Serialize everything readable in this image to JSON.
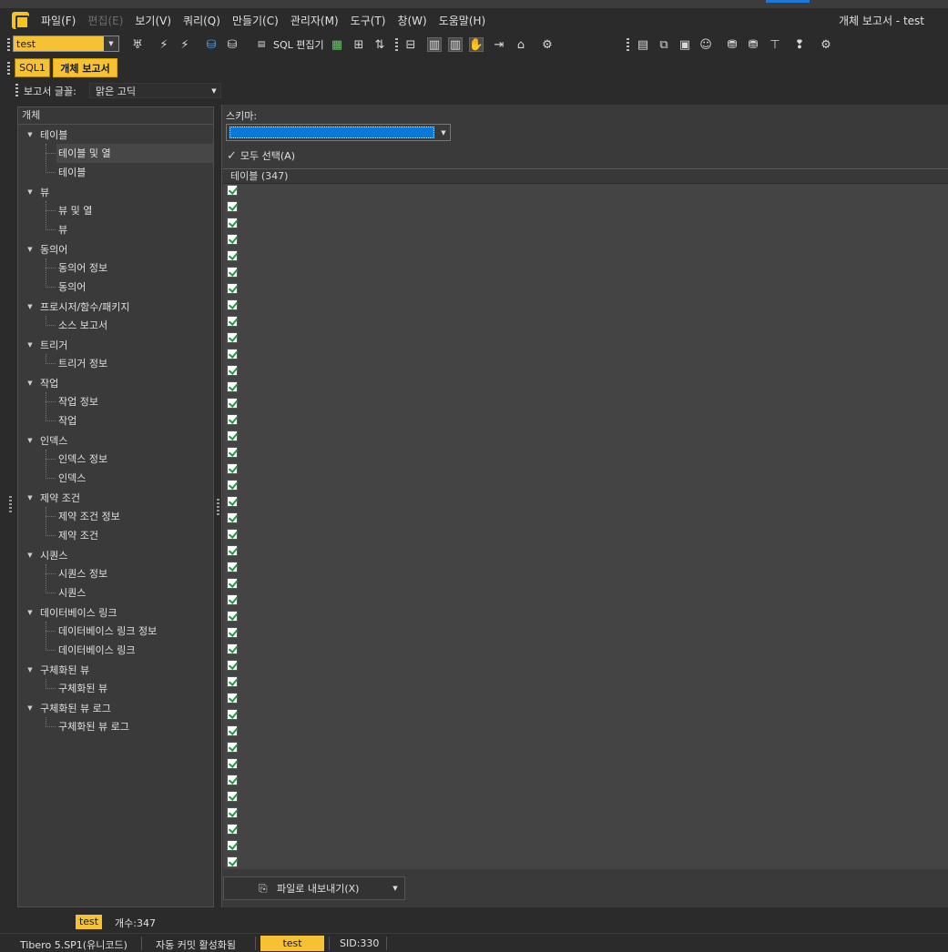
{
  "app": {
    "window_title": "개체 보고서 - test"
  },
  "menu": [
    "파일(F)",
    "편집(E)",
    "보기(V)",
    "쿼리(Q)",
    "만들기(C)",
    "관리자(M)",
    "도구(T)",
    "창(W)",
    "도움말(H)"
  ],
  "toolbar": {
    "connection_value": "test",
    "sql_editor_label": "SQL 편집기"
  },
  "doc_tabs": [
    "SQL1",
    "개체 보고서"
  ],
  "report_font": {
    "label": "보고서 글꼴:",
    "value": "맑은 고딕"
  },
  "tree": {
    "header": "개체",
    "categories": [
      {
        "label": "테이블",
        "items": [
          "테이블 및 열",
          "테이블"
        ]
      },
      {
        "label": "뷰",
        "items": [
          "뷰 및 열",
          "뷰"
        ]
      },
      {
        "label": "동의어",
        "items": [
          "동의어 정보",
          "동의어"
        ]
      },
      {
        "label": "프로시저/함수/패키지",
        "items": [
          "소스 보고서"
        ]
      },
      {
        "label": "트리거",
        "items": [
          "트리거 정보"
        ]
      },
      {
        "label": "작업",
        "items": [
          "작업 정보",
          "작업"
        ]
      },
      {
        "label": "인덱스",
        "items": [
          "인덱스 정보",
          "인덱스"
        ]
      },
      {
        "label": "제약 조건",
        "items": [
          "제약 조건 정보",
          "제약 조건"
        ]
      },
      {
        "label": "시퀀스",
        "items": [
          "시퀀스 정보",
          "시퀀스"
        ]
      },
      {
        "label": "데이터베이스 링크",
        "items": [
          "데이터베이스 링크 정보",
          "데이터베이스 링크"
        ]
      },
      {
        "label": "구체화된 뷰",
        "items": [
          "구체화된 뷰"
        ]
      },
      {
        "label": "구체화된 뷰 로그",
        "items": [
          "구체화된 뷰 로그"
        ]
      }
    ]
  },
  "right": {
    "schema_label": "스키마:",
    "select_all_label": "모두 선택(A)",
    "grid_header": "테이블 (347)",
    "visible_checked_rows": 42,
    "export_label": "파일로 내보내기(X)"
  },
  "left_status": {
    "connection": "test",
    "count": "개수:347"
  },
  "status": {
    "db": "Tibero 5.SP1(유니코드)",
    "autocommit": "자동 커밋 활성화됨",
    "connection": "test",
    "sid": "SID:330"
  },
  "colors": {
    "accent": "#f6c233",
    "selection": "#0a78d8",
    "check": "#1a9a3a"
  }
}
